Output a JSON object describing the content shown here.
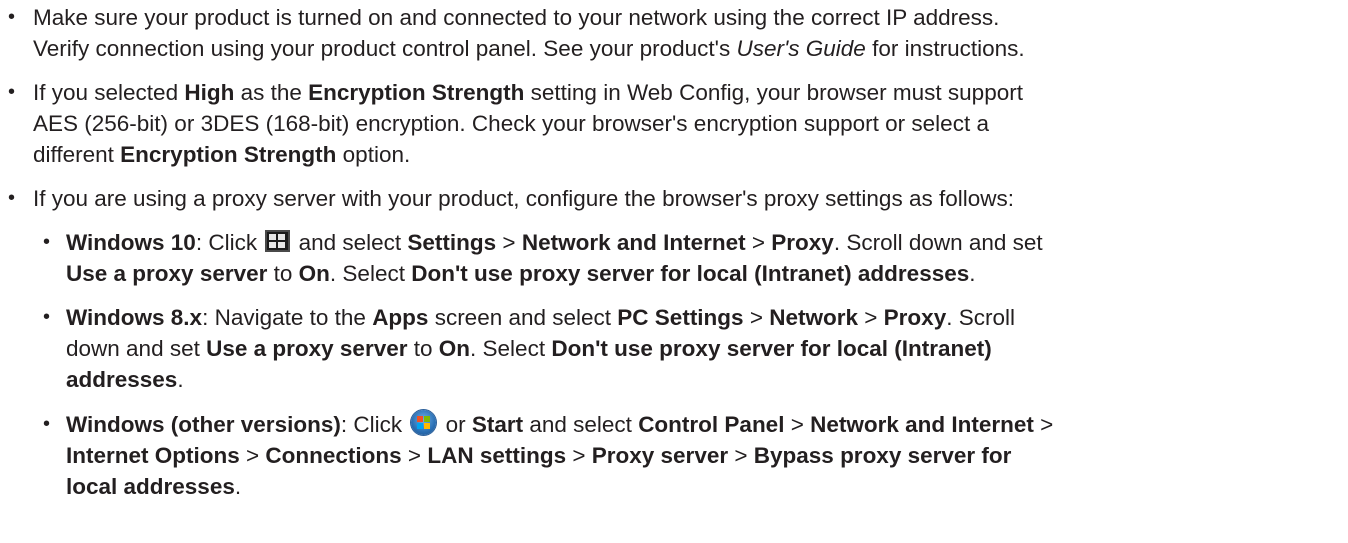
{
  "bullet_glyph": "•",
  "item1": {
    "line1": "Make sure your product is turned on and connected to your network using the correct IP address.",
    "line2_a": "Verify connection using your product control panel. See your product's ",
    "line2_italic": "User's Guide",
    "line2_b": " for instructions."
  },
  "item2": {
    "l1_a": "If you selected ",
    "l1_b1": "High",
    "l1_c": " as the ",
    "l1_b2": "Encryption Strength",
    "l1_d": " setting in Web Config, your browser must support",
    "line2": "AES (256-bit) or 3DES (168-bit) encryption. Check your browser's encryption support or select a",
    "l3_a": "different ",
    "l3_b": "Encryption Strength",
    "l3_c": " option."
  },
  "item3": {
    "line1": "If you are using a proxy server with your product, configure the browser's proxy settings as follows:"
  },
  "win10": {
    "icon": "windows-start-tile-icon",
    "l1_b1": "Windows 10",
    "l1_a": ": Click ",
    "l1_c": " and select ",
    "l1_b2": "Settings",
    "sep": " > ",
    "l1_b3": "Network and Internet",
    "l1_b4": "Proxy",
    "l1_d": ". Scroll down and set",
    "l2_b1": "Use a proxy server",
    "l2_a": " to ",
    "l2_b2": "On",
    "l2_c": ". Select ",
    "l2_b3": "Don't use proxy server for local (Intranet) addresses",
    "l2_d": "."
  },
  "win8": {
    "l1_b1": "Windows 8.x",
    "l1_a": ": Navigate to the ",
    "l1_b2": "Apps",
    "l1_c": " screen and select ",
    "l1_b3": "PC Settings",
    "sep": " > ",
    "l1_b4": "Network",
    "l1_b5": "Proxy",
    "l1_d": ". Scroll",
    "l2_a": "down and set ",
    "l2_b1": "Use a proxy server",
    "l2_c": " to ",
    "l2_b2": "On",
    "l2_d": ". Select ",
    "l2_b3": "Don't use proxy server for local (Intranet)",
    "l3_b": "addresses",
    "l3_c": "."
  },
  "winother": {
    "icon": "windows-start-orb-icon",
    "l1_b1": "Windows (other versions)",
    "l1_a": ": Click ",
    "l1_c": " or ",
    "l1_b2": "Start",
    "l1_d": " and select ",
    "l1_b3": "Control Panel",
    "sep": " > ",
    "l1_b4": "Network and Internet",
    "l1_e": " >",
    "l2_b1": "Internet Options",
    "l2_b2": "Connections",
    "l2_b3": "LAN settings",
    "l2_b4": "Proxy server",
    "l2_b5": "Bypass proxy server for",
    "l3_b": "local addresses",
    "l3_c": "."
  }
}
